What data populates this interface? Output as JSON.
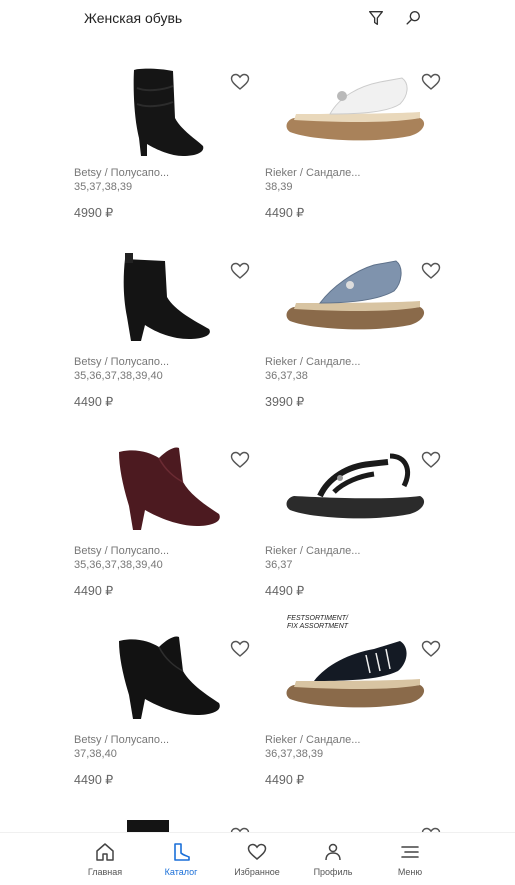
{
  "header": {
    "title": "Женская обувь"
  },
  "products": [
    {
      "brand": "Betsy / Полусапо...",
      "sizes": "35,37,38,39",
      "price": "4990 ₽",
      "image": "tall-slouch-boot"
    },
    {
      "brand": "Rieker / Сандале...",
      "sizes": "38,39",
      "price": "4490 ₽",
      "image": "white-sandal"
    },
    {
      "brand": "Betsy / Полусапо...",
      "sizes": "35,36,37,38,39,40",
      "price": "4490 ₽",
      "image": "black-ankle-boot"
    },
    {
      "brand": "Rieker / Сандале...",
      "sizes": "36,37,38",
      "price": "3990 ₽",
      "image": "blue-sandal"
    },
    {
      "brand": "Betsy / Полусапо...",
      "sizes": "35,36,37,38,39,40",
      "price": "4490 ₽",
      "image": "burgundy-ankle-boot"
    },
    {
      "brand": "Rieker / Сандале...",
      "sizes": "36,37",
      "price": "4490 ₽",
      "image": "black-strap-sandal"
    },
    {
      "brand": "Betsy / Полусапо...",
      "sizes": "37,38,40",
      "price": "4490 ₽",
      "image": "black-ankle-boot-2"
    },
    {
      "brand": "Rieker / Сандале...",
      "sizes": "36,37,38,39",
      "price": "4490 ₽",
      "image": "navy-sandal",
      "badge": "FESTSORTIMENT/\nFIX ASSORTMENT"
    }
  ],
  "nav": {
    "home": "Главная",
    "catalog": "Каталог",
    "favorites": "Избранное",
    "profile": "Профиль",
    "menu": "Меню"
  },
  "colors": {
    "accent": "#1a6fd8",
    "text_muted": "#777777"
  }
}
